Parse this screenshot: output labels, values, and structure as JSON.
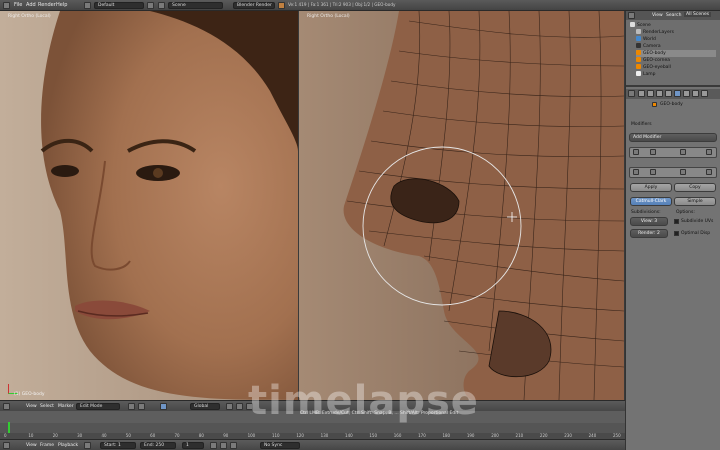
{
  "app": {
    "name": "Blender"
  },
  "topbar": {
    "menus": [
      "File",
      "Add",
      "Render",
      "Help"
    ],
    "layout": "Default",
    "scene": "Scene",
    "engine": "Blender Render",
    "stats": "Ve:1 419 | Fa:1 361 | Tri:2 903 | Obj:1/2 | GEO-body"
  },
  "viewport_left": {
    "label": "Right Ortho (Local)",
    "object": "(1) GEO-body"
  },
  "viewport_right": {
    "label": "Right Ortho (Local)",
    "object": "(1) GEO-body"
  },
  "outliner": {
    "tabs": [
      "View",
      "Search",
      "All Scenes"
    ],
    "items": [
      "Scene",
      "RenderLayers",
      "World",
      "Camera",
      "GEO-body",
      "GEO-cornea",
      "GEO-eyeball",
      "Lamp"
    ]
  },
  "properties": {
    "object": "GEO-body",
    "section": "Modifiers",
    "add_modifier": "Add Modifier",
    "apply": "Apply",
    "copy": "Copy",
    "catmull": "Catmull-Clark",
    "simple": "Simple",
    "subdivisions_label": "Subdivisions:",
    "options_label": "Options:",
    "view": "View: 3",
    "render": "Render: 2",
    "subdivide_uvs": "Subdivide UVs",
    "optimal_display": "Optimal Disp"
  },
  "timeline": {
    "header": [
      "View",
      "Select",
      "Marker",
      "Edit Mode",
      "Global"
    ],
    "ticks": [
      "0",
      "10",
      "20",
      "30",
      "40",
      "50",
      "60",
      "70",
      "80",
      "90",
      "100",
      "110",
      "120",
      "130",
      "140",
      "150",
      "160",
      "170",
      "180",
      "190",
      "200",
      "210",
      "220",
      "230",
      "240",
      "250"
    ],
    "hint": "Ctrl LMB: Extrude/Cut, Ctrl Shift: Snap, B, ... Shift/Alt: Proportional Edit"
  },
  "footer": {
    "menus": [
      "View",
      "Frame",
      "Playback"
    ],
    "start": "Start: 1",
    "end": "End: 250",
    "current": "1",
    "sync": "No Sync"
  },
  "watermark": "timelapse",
  "colors": {
    "accent": "#5580b8",
    "panel": "#737373",
    "header": "#4a4a4a"
  }
}
